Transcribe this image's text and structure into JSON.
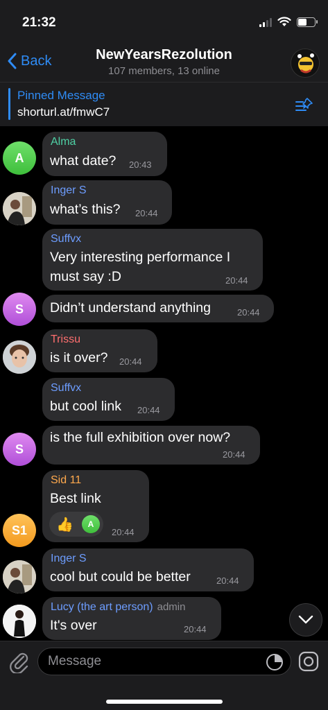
{
  "status_bar": {
    "time": "21:32"
  },
  "header": {
    "back_label": "Back",
    "title": "NewYearsRezolution",
    "subtitle": "107 members, 13 online"
  },
  "pinned": {
    "title": "Pinned Message",
    "text": "shorturl.at/fmwC7"
  },
  "messages": [
    {
      "sender": "Alma",
      "sender_color": "#4fd1a5",
      "text": "what date?",
      "time": "20:43",
      "avatar_letter": "A"
    },
    {
      "sender": "Inger S",
      "sender_color": "#6d9dff",
      "text": "what’s this?",
      "time": "20:44"
    },
    {
      "sender": "Suffvx",
      "sender_color": "#6d9dff",
      "text_line1": "Very interesting performance I",
      "text_line2": "must say :D",
      "time": "20:44"
    },
    {
      "text": "Didn’t understand anything",
      "time": "20:44",
      "avatar_letter": "S"
    },
    {
      "sender": "Trissu",
      "sender_color": "#ff6f6f",
      "text": "is it over?",
      "time": "20:44"
    },
    {
      "sender": "Suffvx",
      "sender_color": "#6d9dff",
      "text": "but cool link",
      "time": "20:44"
    },
    {
      "text": "is the full exhibition over now?",
      "time": "20:44",
      "avatar_letter": "S"
    },
    {
      "sender": "Sid 11",
      "sender_color": "#ffa94d",
      "text": "Best link",
      "time": "20:44",
      "avatar_letter": "S1",
      "reaction_emoji": "👍",
      "reaction_user": "A"
    },
    {
      "sender": "Inger S",
      "sender_color": "#6d9dff",
      "text": "cool but could be better",
      "time": "20:44"
    },
    {
      "sender": "Lucy (the art person)",
      "sender_color": "#6d9dff",
      "badge": "admin",
      "text": "It's over",
      "time": "20:44"
    }
  ],
  "input": {
    "placeholder": "Message"
  },
  "colors": {
    "accent": "#2f8cf6",
    "bubble": "#2c2c2e",
    "bar": "#1c1c1e"
  }
}
